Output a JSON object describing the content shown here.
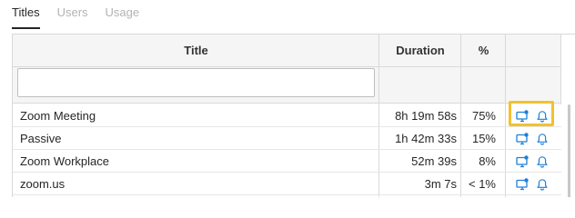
{
  "tabs": [
    {
      "label": "Titles",
      "active": true
    },
    {
      "label": "Users",
      "active": false
    },
    {
      "label": "Usage",
      "active": false
    }
  ],
  "table": {
    "columns": {
      "title": "Title",
      "duration": "Duration",
      "percent": "%"
    },
    "filter": {
      "value": "",
      "placeholder": ""
    },
    "rows": [
      {
        "title": "Zoom Meeting",
        "duration": "8h 19m 58s",
        "percent": "75%"
      },
      {
        "title": "Passive",
        "duration": "1h 42m 33s",
        "percent": "15%"
      },
      {
        "title": "Zoom Workplace",
        "duration": "52m 39s",
        "percent": "8%"
      },
      {
        "title": "zoom.us",
        "duration": "3m 7s",
        "percent": "< 1%"
      }
    ],
    "row_icons": [
      "monitor-settings-icon",
      "bell-icon"
    ]
  },
  "colors": {
    "icon_blue": "#1e7fd6",
    "highlight": "#f2c12e",
    "header_bg": "#f5f5f5"
  }
}
